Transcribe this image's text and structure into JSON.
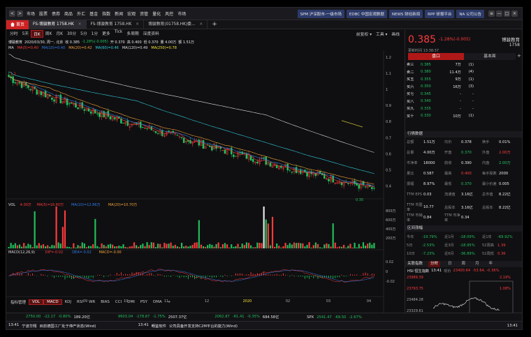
{
  "nav": {
    "back": "<",
    "fwd": ">",
    "menu": [
      "市场",
      "股票",
      "债券",
      "商品",
      "外汇",
      "基金",
      "指数",
      "新闻",
      "宏观",
      "资管",
      "量化",
      "风控",
      "市场"
    ],
    "news_buttons": [
      "SPM 沪深股市-一级市场",
      "EDBC 中国宏观数据",
      "NEWS 财经新闻",
      "RPP 研报平台",
      "NA 公司公告"
    ],
    "win_controls": [
      "≡",
      "—",
      "□",
      "×"
    ]
  },
  "tabs": {
    "home": "首页",
    "items": [
      "FS-博骏教育 1758.HK",
      "FS-博骏教育 1758.HK",
      "博骏教育(01758.HK)委..."
    ],
    "add": "+"
  },
  "toolbar": {
    "left": [
      "分时",
      "5天",
      "日K",
      "周K",
      "月K",
      "30分",
      "5分",
      "1分",
      "更多",
      "Tick",
      "多周期",
      "深度资料"
    ],
    "selected": "日K",
    "right": [
      "前复权",
      "工具",
      "画线"
    ]
  },
  "chart_info": {
    "name": "博骏教育",
    "date_line": "2020/03/30, 周一, 北京",
    "quote": [
      "收 0.385",
      "-1.28%(-0.005)",
      "开 0.370",
      "高 0.400",
      "低 0.370",
      "量 4.00万",
      "额 1.51万"
    ]
  },
  "ma_legend": [
    {
      "label": "MA",
      "color": "#dddddd"
    },
    {
      "label": "MA(5)=0.40",
      "color": "#ff3b3b"
    },
    {
      "label": "MA(10)=0.40",
      "color": "#2f7be8"
    },
    {
      "label": "MA(20)=0.42",
      "color": "#f2a23a"
    },
    {
      "label": "MA(60)=0.46",
      "color": "#2fd0e0"
    },
    {
      "label": "MA(120)=0.49",
      "color": "#dddddd"
    },
    {
      "label": "MA(250)=0.78",
      "color": "#f2e23a"
    }
  ],
  "price_axis": [
    "1.2",
    "1.1",
    "1",
    "0.9",
    "0.8",
    "0.7",
    "0.6",
    "0.5",
    "0.4"
  ],
  "price_markers": {
    "high": "1.1",
    "low": "0.35"
  },
  "vol_legend": [
    {
      "label": "VOL",
      "color": "#dddddd"
    },
    {
      "label": "4.00万",
      "color": "#ff3b3b"
    },
    {
      "label": "MA(5)=16.60万",
      "color": "#ff3b3b"
    },
    {
      "label": "MA(10)=12.86万",
      "color": "#2f7be8"
    },
    {
      "label": "MA(20)=10.70万",
      "color": "#f2a23a"
    }
  ],
  "vol_axis": [
    "800万",
    "600万",
    "400万",
    "200万"
  ],
  "macd_legend": [
    {
      "label": "MACD(12,26,9)",
      "color": "#dddddd"
    },
    {
      "label": "DIF=-0.02",
      "color": "#ff3b3b"
    },
    {
      "label": "DEA=-0.02",
      "color": "#2f7be8"
    },
    {
      "label": "MACD=-0.00",
      "color": "#f2a23a"
    }
  ],
  "macd_axis": [
    "0.02",
    "0",
    "-0.02"
  ],
  "x_axis": [
    "08",
    "09",
    "10",
    "11",
    "12",
    "2020",
    "02",
    "03",
    "04"
  ],
  "indicator_tabs": [
    "指标管理",
    "VOL",
    "MACD",
    "KDJ",
    "RSI",
    "WR",
    "BIAS",
    "CCI",
    "DMI",
    "PSY",
    "DMA",
    "+"
  ],
  "indicator_selected": [
    "VOL",
    "MACD"
  ],
  "quote_panel": {
    "price": "0.385",
    "change": "-1.28%(-0.005)",
    "name": "博骏教育",
    "code": "1758",
    "update": "更新时间 13:38:37",
    "tab_left": "盘口",
    "tab_right": "基本面",
    "order_book": [
      {
        "label": "卖三",
        "price": "0.385",
        "vol": "7万",
        "n": "(1)"
      },
      {
        "label": "卖二",
        "price": "0.380",
        "vol": "11.4万",
        "n": "(4)"
      },
      {
        "label": "买五",
        "price": "0.355",
        "vol": "9万",
        "n": "(1)"
      },
      {
        "label": "买六",
        "price": "0.350",
        "vol": "16万",
        "n": "(3)"
      },
      {
        "label": "买七",
        "price": "0.345",
        "vol": "-",
        "n": "-"
      },
      {
        "label": "买八",
        "price": "0.340",
        "vol": "-",
        "n": "-"
      },
      {
        "label": "买九",
        "price": "0.335",
        "vol": "-",
        "n": "-"
      },
      {
        "label": "买十",
        "price": "0.330",
        "vol": "10万",
        "n": "(1)"
      }
    ],
    "stats_title": "行情数据",
    "stats": [
      [
        "总额",
        "1.51万",
        "均价",
        "0.378",
        "换手",
        "0.01%"
      ],
      [
        "总量",
        "4.00万",
        "开盘",
        "0.370",
        "外盘",
        "2.00万"
      ],
      [
        "市净率",
        "18000",
        "前收",
        "0.390",
        "内盘",
        "2.00万"
      ],
      [
        "量比",
        "0.587",
        "最高",
        "0.400",
        "每手股数",
        "2000"
      ],
      [
        "振幅",
        "8.97%",
        "最低",
        "0.370",
        "最小价差",
        "0.005"
      ],
      [
        "TTM EPS",
        "0.03",
        "流通值",
        "3.16亿",
        "总市值",
        "8.22亿"
      ],
      [
        "TTM 市盈率",
        "10.77",
        "总股本",
        "3.16亿",
        "总股本",
        "8.22亿"
      ],
      [
        "TTM 市销率",
        "0.84",
        "TTM 市净率",
        "0.34",
        "",
        ""
      ]
    ],
    "range_title": "区间涨幅",
    "ranges": [
      [
        "今年",
        "-19.79%",
        "近1月",
        "-18.09%",
        "近1年",
        "-69.92%"
      ],
      [
        "5日",
        "-2.53%",
        "近3月",
        "-18.95%",
        "52周高",
        "1.39"
      ],
      [
        "10日",
        "-7.23%",
        "近6月",
        "-36.89%",
        "52周低",
        "0.36"
      ]
    ],
    "related_title": "关联指数",
    "related_tabs": [
      "分时",
      "日",
      "周",
      "月",
      "年"
    ],
    "related_index": "HSI 恒生指数",
    "related_time": "13:41",
    "related_quote": "23400.64",
    "related_change": "-53.64, -0.36%",
    "related_axis": [
      "23989.39",
      "23793.75",
      "23484.28",
      "23329.61"
    ],
    "related_pct": [
      "2.19%",
      "1.08%"
    ]
  },
  "ticker": [
    {
      "v": "2750.00",
      "c": "-22.17",
      "p": "-0.80%",
      "amt": "189.20亿"
    },
    {
      "v": "9603.04",
      "c": "-178.87",
      "p": "-1.75%",
      "amt": "2507.37亿"
    },
    {
      "v": "2062.87",
      "c": "-61.41",
      "p": "-0.35%",
      "amt": "684.58亿"
    },
    {
      "label": "SPX",
      "v": "2541.47",
      "c": "-69.50",
      "p": "-2.67%"
    }
  ],
  "news": [
    {
      "time": "13:41",
      "src": "宁波华翔",
      "text": "目前德国工厂处于停产状态(Wind)"
    },
    {
      "time": "13:41",
      "src": "畅鉴软件",
      "text": "公司具备开发支持C2M平台的能力(Wind)"
    }
  ],
  "clock": "13:41",
  "chart_data": {
    "type": "candlestick",
    "title": "博骏教育",
    "x_ticks": [
      "08",
      "09",
      "10",
      "11",
      "12",
      "2020",
      "02",
      "03",
      "04"
    ],
    "price_range": [
      0.35,
      1.2
    ],
    "start_price": 1.08,
    "end_price": 0.385,
    "ma_series": [
      {
        "name": "MA(120)",
        "end": 0.49
      },
      {
        "name": "MA(60)",
        "end": 0.46
      },
      {
        "name": "MA(20)",
        "end": 0.42
      },
      {
        "name": "MA(5)",
        "end": 0.4
      }
    ],
    "volume_range": [
      0,
      800
    ],
    "macd_range": [
      -0.03,
      0.03
    ]
  }
}
